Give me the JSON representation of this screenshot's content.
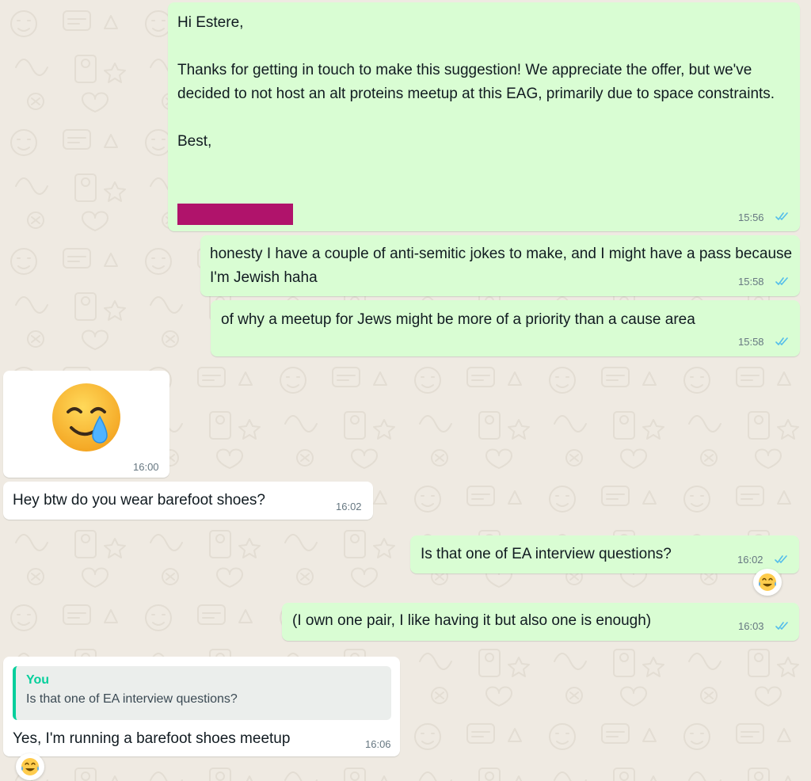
{
  "colors": {
    "outgoing_bubble": "#d9fdd3",
    "incoming_bubble": "#ffffff",
    "wallpaper": "#efeae2",
    "read_ticks": "#53bdeb",
    "quote_accent": "#06cf9c",
    "redaction": "#b0136b"
  },
  "messages": [
    {
      "direction": "outgoing",
      "text": "Hi Estere,\n\nThanks for getting in touch to make this suggestion! We appreciate the offer, but we've decided to not host an alt proteins meetup at this EAG, primarily due to space constraints.\n\nBest,",
      "redacted_signature": true,
      "time": "15:56",
      "status_icon": "double-check-read-icon"
    },
    {
      "direction": "outgoing",
      "text": "honesty I have a couple of anti-semitic jokes to make, and I might have a pass because I'm Jewish haha",
      "time": "15:58",
      "status_icon": "double-check-read-icon"
    },
    {
      "direction": "outgoing",
      "text": "of why a meetup for Jews might be more of a priority than a cause area",
      "time": "15:58",
      "status_icon": "double-check-read-icon"
    },
    {
      "direction": "incoming",
      "emoji": "smiling-face-with-tear-icon",
      "time": "16:00"
    },
    {
      "direction": "incoming",
      "text": "Hey btw do you wear barefoot shoes?",
      "time": "16:02"
    },
    {
      "direction": "outgoing",
      "text": "Is that one of EA interview questions?",
      "time": "16:02",
      "status_icon": "double-check-read-icon",
      "reaction": "face-with-tears-of-joy-icon"
    },
    {
      "direction": "outgoing",
      "text": "(I own one pair, I like having it but also one is enough)",
      "time": "16:03",
      "status_icon": "double-check-read-icon"
    },
    {
      "direction": "incoming",
      "quote": {
        "author": "You",
        "text": "Is that one of EA interview questions?"
      },
      "text": "Yes, I'm running a barefoot shoes meetup",
      "time": "16:06",
      "reaction": "face-with-tears-of-joy-icon"
    }
  ]
}
